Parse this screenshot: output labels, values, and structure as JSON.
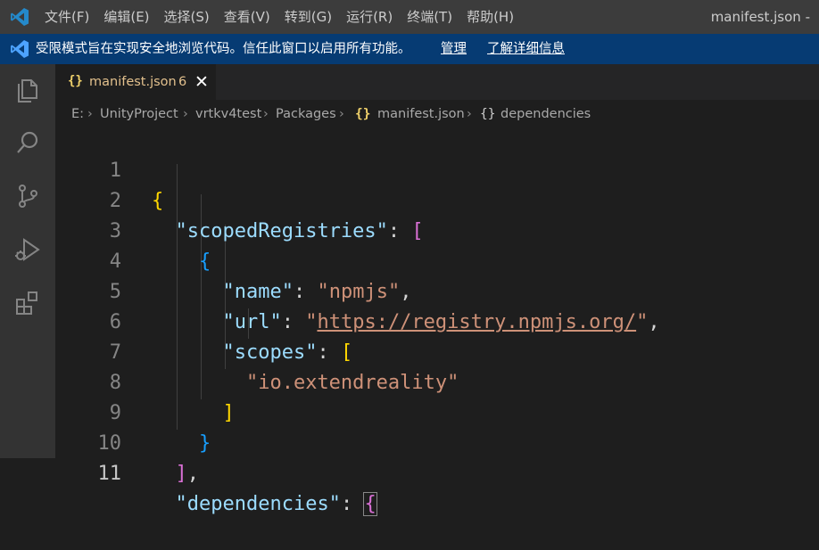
{
  "titlebar": {
    "menu": [
      "文件(F)",
      "编辑(E)",
      "选择(S)",
      "查看(V)",
      "转到(G)",
      "运行(R)",
      "终端(T)",
      "帮助(H)"
    ],
    "window_title": "manifest.json -"
  },
  "banner": {
    "message": "受限模式旨在实现安全地浏览代码。信任此窗口以启用所有功能。",
    "manage_link": "管理",
    "learn_more_link": "了解详细信息"
  },
  "activity_bar": {
    "icons": [
      "explorer-icon",
      "search-icon",
      "source-control-icon",
      "run-debug-icon",
      "extensions-icon"
    ]
  },
  "tab": {
    "icon": "{}",
    "filename": "manifest.json",
    "problems": "6",
    "close": "✕"
  },
  "breadcrumb": {
    "items": [
      "E:",
      "UnityProject",
      "vrtkv4test",
      "Packages",
      "manifest.json",
      "dependencies"
    ],
    "file_icon": "{}",
    "object_icon": "{}"
  },
  "editor": {
    "line_numbers": [
      "1",
      "2",
      "3",
      "4",
      "5",
      "6",
      "7",
      "8",
      "9",
      "10",
      "11"
    ],
    "tokens": {
      "l1_brace": "{",
      "l2_key": "\"scopedRegistries\"",
      "l2_colon": ": ",
      "l2_bracket": "[",
      "l3_brace": "{",
      "l4_key": "\"name\"",
      "l4_colon": ": ",
      "l4_value": "\"npmjs\"",
      "l4_comma": ",",
      "l5_key": "\"url\"",
      "l5_colon": ": ",
      "l5_quote_open": "\"",
      "l5_url": "https://registry.npmjs.org/",
      "l5_quote_close": "\"",
      "l5_comma": ",",
      "l6_key": "\"scopes\"",
      "l6_colon": ": ",
      "l6_bracket": "[",
      "l7_value": "\"io.extendreality\"",
      "l8_bracket": "]",
      "l9_brace": "}",
      "l10_bracket": "]",
      "l10_comma": ",",
      "l11_key": "\"dependencies\"",
      "l11_colon": ": ",
      "l11_brace": "{"
    }
  }
}
